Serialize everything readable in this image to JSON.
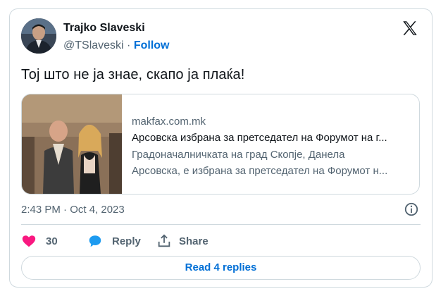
{
  "author": {
    "name": "Trajko Slaveski",
    "handle": "@TSlaveski",
    "separator": "·",
    "follow_label": "Follow"
  },
  "tweet": {
    "text": "Тој што не ја знае, скапо ја плаќа!"
  },
  "link_card": {
    "domain": "makfax.com.mk",
    "title": "Арсовска избрана за претседател на Форумот на г...",
    "description_line1": "Градоначалничката на град Скопје, Данела",
    "description_line2": "Арсовска, е избрана за претседател на Форумот н..."
  },
  "meta": {
    "timestamp": "2:43 PM · Oct 4, 2023"
  },
  "actions": {
    "like_count": "30",
    "reply_label": "Reply",
    "share_label": "Share"
  },
  "replies_button": {
    "label": "Read 4 replies"
  },
  "colors": {
    "link_blue": "#006fd6",
    "like_pink": "#f91880",
    "reply_blue": "#1d9bf0",
    "secondary_text": "#536471",
    "border": "#cfd9de"
  },
  "icons": [
    "x-logo-icon",
    "info-icon",
    "heart-icon",
    "reply-bubble-icon",
    "share-icon"
  ]
}
